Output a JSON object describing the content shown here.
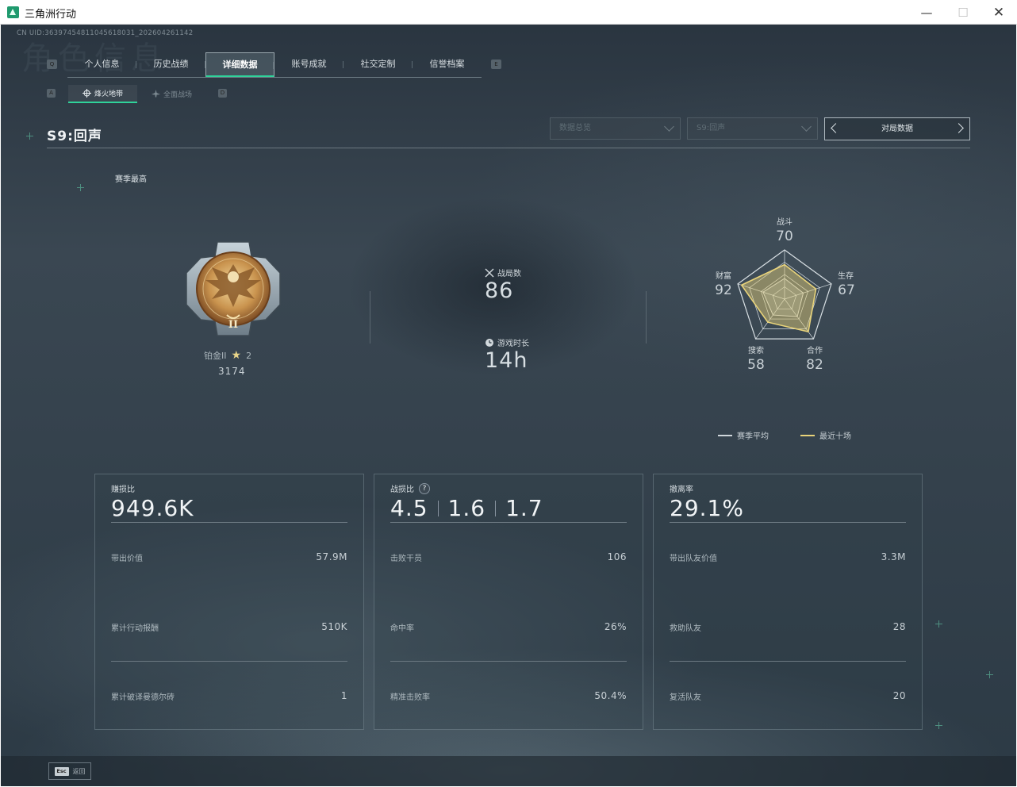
{
  "window": {
    "title": "三角洲行动",
    "minimize": "—",
    "maximize": "☐",
    "close": "✕"
  },
  "uid": "CN UID:36397454811045618031_202604261142",
  "watermark": "角色信息",
  "main_tabs": {
    "left_key": "Q",
    "right_key": "E",
    "items": [
      {
        "label": "个人信息",
        "active": false
      },
      {
        "label": "历史战绩",
        "active": false
      },
      {
        "label": "详细数据",
        "active": true
      },
      {
        "label": "账号成就",
        "active": false
      },
      {
        "label": "社交定制",
        "active": false
      },
      {
        "label": "信誉档案",
        "active": false
      }
    ]
  },
  "sub_tabs": {
    "left_key": "A",
    "right_key": "D",
    "items": [
      {
        "label": "烽火地带",
        "icon": "crosshair-icon",
        "active": true
      },
      {
        "label": "全面战场",
        "icon": "plane-icon",
        "active": false
      }
    ]
  },
  "season": {
    "title": "S9:回声",
    "best_label": "赛季最高"
  },
  "filters": {
    "data_overview": "数据总览",
    "season_select": "S9:回声",
    "match_data": "对局数据"
  },
  "rank": {
    "name": "铂金II",
    "stars": "2",
    "score": "3174",
    "emblem_numeral": "II"
  },
  "summary": {
    "matches_label": "战局数",
    "matches_value": "86",
    "playtime_label": "游戏时长",
    "playtime_value": "14h"
  },
  "radar": {
    "axes": [
      {
        "label": "战斗",
        "value": "70"
      },
      {
        "label": "生存",
        "value": "67"
      },
      {
        "label": "合作",
        "value": "82"
      },
      {
        "label": "搜索",
        "value": "58"
      },
      {
        "label": "财富",
        "value": "92"
      }
    ],
    "season_avg": [
      0.42,
      0.4,
      0.44,
      0.4,
      0.46
    ],
    "recent_ten": [
      0.7,
      0.67,
      0.82,
      0.58,
      0.92
    ],
    "legend_avg": "赛季平均",
    "legend_recent": "最近十场",
    "color_avg": "#cfd6db",
    "color_recent": "#e8d37a"
  },
  "cards": [
    {
      "label": "赚损比",
      "value": "949.6K",
      "rows": [
        {
          "label": "带出价值",
          "value": "57.9M"
        },
        {
          "label": "累计行动报酬",
          "value": "510K"
        },
        {
          "label": "累计破译曼德尔砖",
          "value": "1"
        }
      ]
    },
    {
      "label": "战损比",
      "values": [
        "4.5",
        "1.6",
        "1.7"
      ],
      "help": "?",
      "rows": [
        {
          "label": "击败干员",
          "value": "106"
        },
        {
          "label": "命中率",
          "value": "26%"
        },
        {
          "label": "精准击败率",
          "value": "50.4%"
        }
      ]
    },
    {
      "label": "撤离率",
      "value": "29.1%",
      "rows": [
        {
          "label": "带出队友价值",
          "value": "3.3M"
        },
        {
          "label": "救助队友",
          "value": "28"
        },
        {
          "label": "复活队友",
          "value": "20"
        }
      ]
    }
  ],
  "footer": {
    "esc_key": "Esc",
    "back_label": "返回"
  }
}
